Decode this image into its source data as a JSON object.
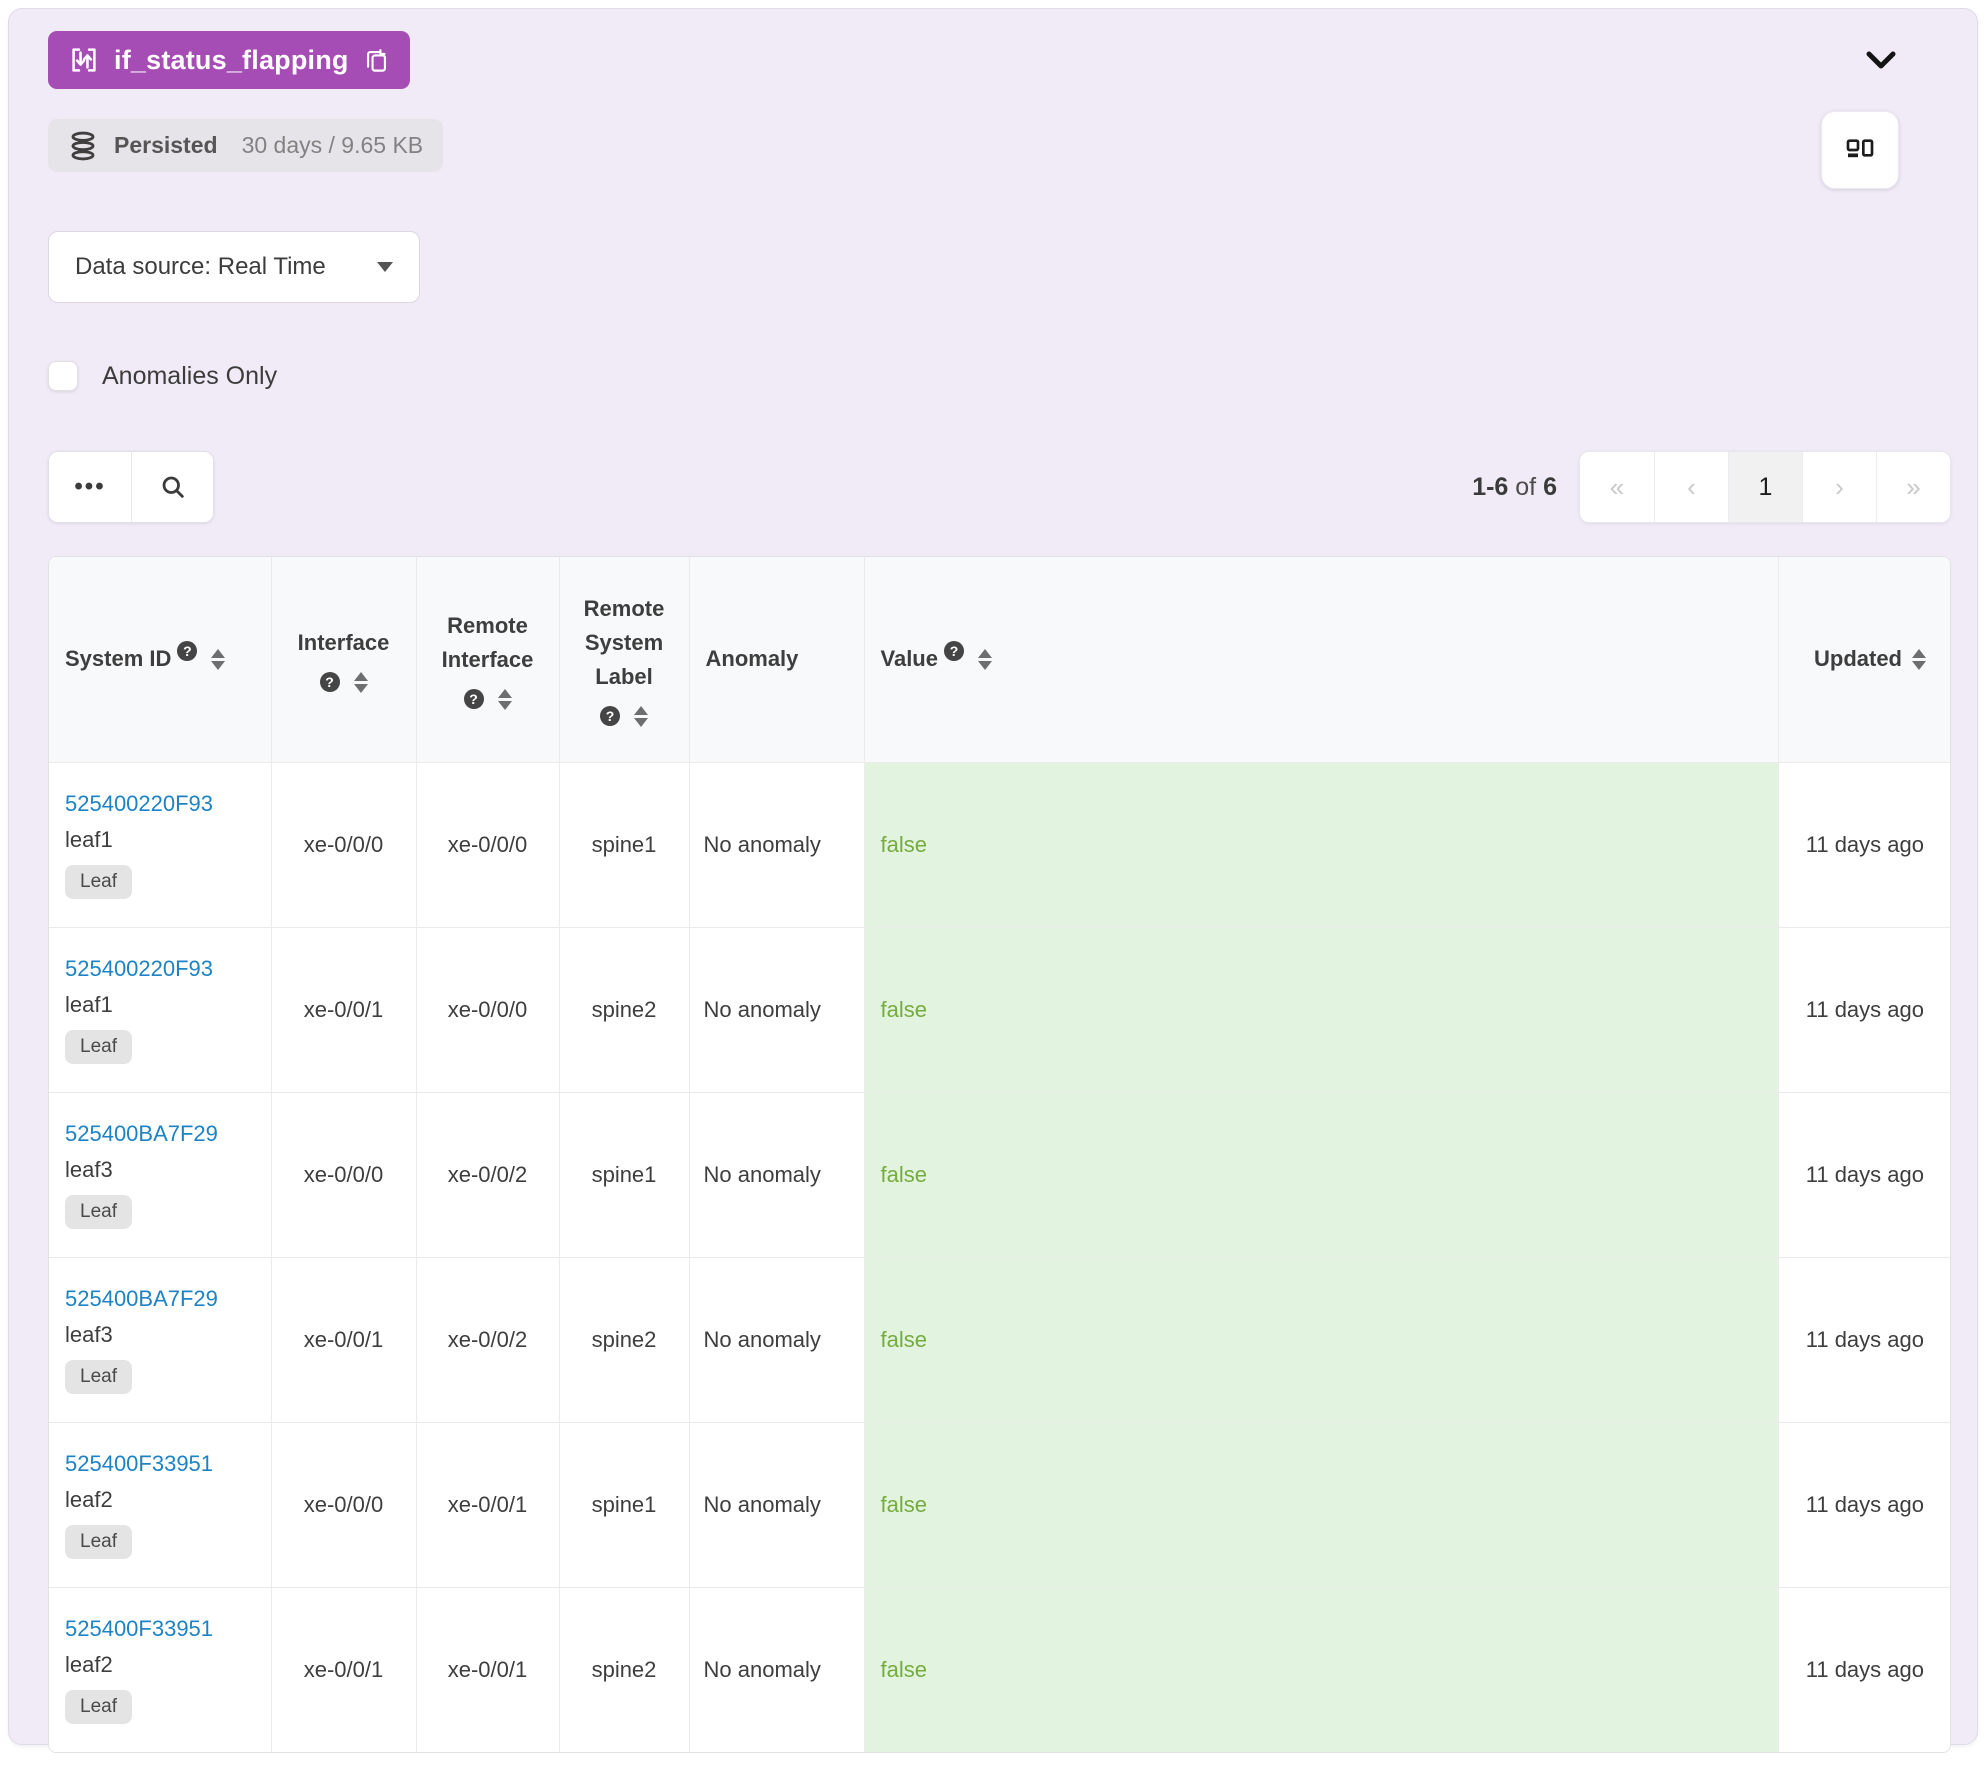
{
  "probe": {
    "name": "if_status_flapping"
  },
  "persistence": {
    "label": "Persisted",
    "detail": "30 days / 9.65 KB"
  },
  "datasource": {
    "value": "Data source: Real Time"
  },
  "filters": {
    "anomalies_only_label": "Anomalies Only",
    "anomalies_only_checked": false
  },
  "toolbar": {
    "more_icon": "•••"
  },
  "pagination": {
    "range": "1-6",
    "of_word": "of",
    "total": "6",
    "first_icon": "«",
    "prev_icon": "‹",
    "current_page": "1",
    "next_icon": "›",
    "last_icon": "»"
  },
  "table": {
    "help_glyph": "?",
    "columns": [
      {
        "id": "system_id",
        "label": "System ID",
        "help": true,
        "sortable": true,
        "align": "left",
        "stacked": false
      },
      {
        "id": "interface",
        "label": "Interface",
        "help": true,
        "sortable": true,
        "align": "center",
        "stacked": true
      },
      {
        "id": "remote_interface",
        "label": "Remote Interface",
        "help": true,
        "sortable": true,
        "align": "center",
        "stacked": true
      },
      {
        "id": "remote_system_label",
        "label": "Remote System Label",
        "help": true,
        "sortable": true,
        "align": "center",
        "stacked": true
      },
      {
        "id": "anomaly",
        "label": "Anomaly",
        "help": false,
        "sortable": false,
        "align": "left",
        "stacked": false
      },
      {
        "id": "value",
        "label": "Value",
        "help": true,
        "sortable": true,
        "align": "left",
        "stacked": false
      },
      {
        "id": "updated",
        "label": "Updated",
        "help": false,
        "sortable": true,
        "align": "right",
        "stacked": false
      }
    ],
    "rows": [
      {
        "system_id": "525400220F93",
        "system_name": "leaf1",
        "role_badge": "Leaf",
        "interface": "xe-0/0/0",
        "remote_interface": "xe-0/0/0",
        "remote_system_label": "spine1",
        "anomaly": "No anomaly",
        "value": "false",
        "updated": "11 days ago"
      },
      {
        "system_id": "525400220F93",
        "system_name": "leaf1",
        "role_badge": "Leaf",
        "interface": "xe-0/0/1",
        "remote_interface": "xe-0/0/0",
        "remote_system_label": "spine2",
        "anomaly": "No anomaly",
        "value": "false",
        "updated": "11 days ago"
      },
      {
        "system_id": "525400BA7F29",
        "system_name": "leaf3",
        "role_badge": "Leaf",
        "interface": "xe-0/0/0",
        "remote_interface": "xe-0/0/2",
        "remote_system_label": "spine1",
        "anomaly": "No anomaly",
        "value": "false",
        "updated": "11 days ago"
      },
      {
        "system_id": "525400BA7F29",
        "system_name": "leaf3",
        "role_badge": "Leaf",
        "interface": "xe-0/0/1",
        "remote_interface": "xe-0/0/2",
        "remote_system_label": "spine2",
        "anomaly": "No anomaly",
        "value": "false",
        "updated": "11 days ago"
      },
      {
        "system_id": "525400F33951",
        "system_name": "leaf2",
        "role_badge": "Leaf",
        "interface": "xe-0/0/0",
        "remote_interface": "xe-0/0/1",
        "remote_system_label": "spine1",
        "anomaly": "No anomaly",
        "value": "false",
        "updated": "11 days ago"
      },
      {
        "system_id": "525400F33951",
        "system_name": "leaf2",
        "role_badge": "Leaf",
        "interface": "xe-0/0/1",
        "remote_interface": "xe-0/0/1",
        "remote_system_label": "spine2",
        "anomaly": "No anomaly",
        "value": "false",
        "updated": "11 days ago"
      }
    ]
  },
  "colors": {
    "accent_purple": "#a64db5",
    "link_blue": "#1d83c4",
    "value_green_text": "#76ab3f",
    "value_green_bg": "#e2f3df",
    "panel_lavender": "#f1ebf7"
  }
}
